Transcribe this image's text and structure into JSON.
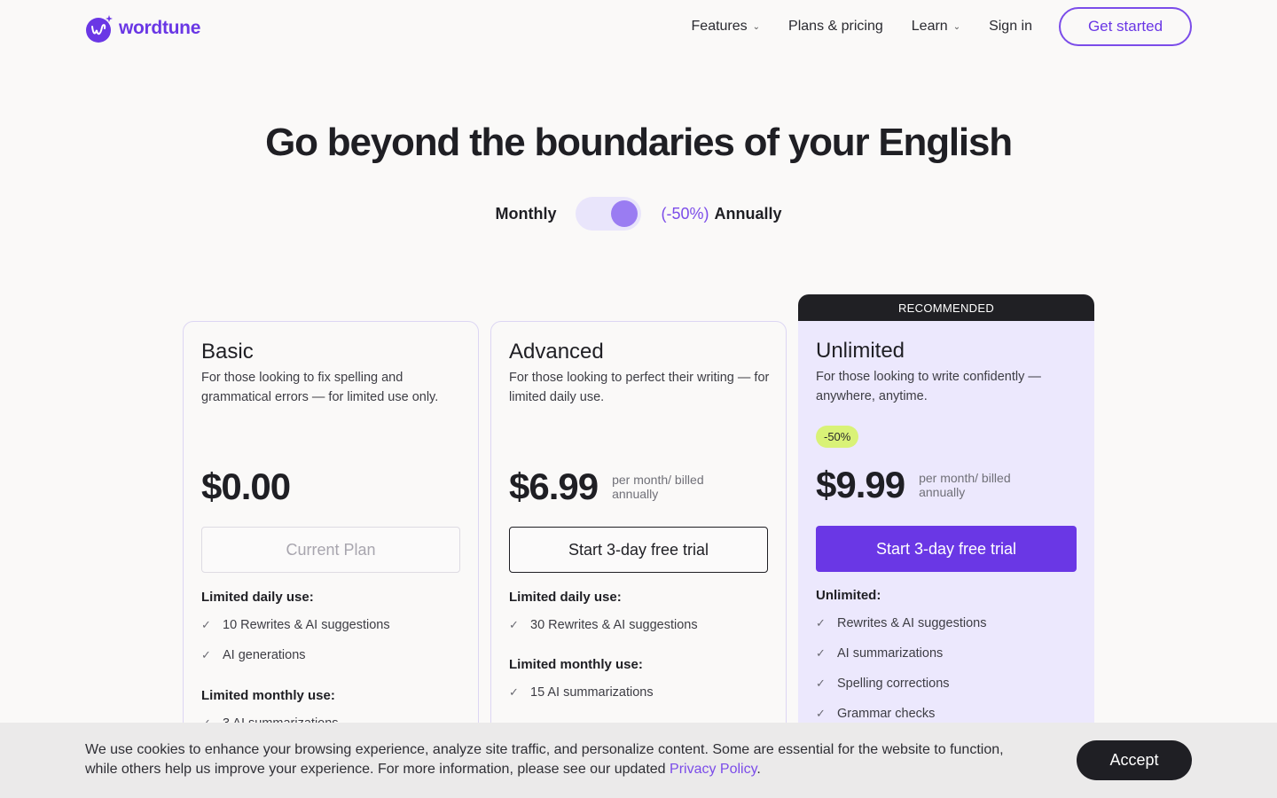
{
  "brand": {
    "name": "wordtune",
    "color": "#6a37e5"
  },
  "nav": {
    "items": [
      {
        "label": "Features",
        "dropdown": true
      },
      {
        "label": "Plans & pricing",
        "dropdown": false
      },
      {
        "label": "Learn",
        "dropdown": true
      },
      {
        "label": "Sign in",
        "dropdown": false
      }
    ],
    "cta": "Get started"
  },
  "hero": {
    "title": "Go beyond the boundaries of your English"
  },
  "billing": {
    "monthly": "Monthly",
    "discount": "(-50%)",
    "annually": "Annually",
    "selected": "Annually"
  },
  "plans": [
    {
      "name": "Basic",
      "desc": "For those looking to fix spelling and grammatical errors — for limited use only.",
      "price": "$0.00",
      "per": "",
      "button": "Current Plan",
      "sections": [
        {
          "title": "Limited daily use:",
          "features": [
            "10 Rewrites & AI suggestions",
            "AI generations"
          ]
        },
        {
          "title": "Limited monthly use:",
          "features": [
            "3 AI summarizations"
          ]
        }
      ]
    },
    {
      "name": "Advanced",
      "desc": "For those looking to perfect their writing — for limited daily use.",
      "price": "$6.99",
      "per": "per month/ billed annually",
      "button": "Start 3-day free trial",
      "sections": [
        {
          "title": "Limited daily use:",
          "features": [
            "30 Rewrites & AI suggestions"
          ]
        },
        {
          "title": "Limited monthly use:",
          "features": [
            "15 AI summarizations"
          ]
        }
      ]
    },
    {
      "name": "Unlimited",
      "ribbon": "RECOMMENDED",
      "badge": "-50%",
      "desc": "For those looking to write confidently — anywhere, anytime.",
      "price": "$9.99",
      "per": "per month/ billed annually",
      "button": "Start 3-day free trial",
      "sections": [
        {
          "title": "Unlimited:",
          "features": [
            "Rewrites & AI suggestions",
            "AI summarizations",
            "Spelling corrections",
            "Grammar checks"
          ]
        }
      ]
    }
  ],
  "cookie": {
    "text": "We use cookies to enhance your browsing experience, analyze site traffic, and personalize content. Some are essential for the website to function, while others help us improve your experience. For more information, please see our updated ",
    "link": "Privacy Policy",
    "end": ".",
    "accept": "Accept"
  },
  "colors": {
    "accent": "#6a37e5",
    "badge": "#d9f277",
    "recommended_bg": "#ece8fd"
  }
}
